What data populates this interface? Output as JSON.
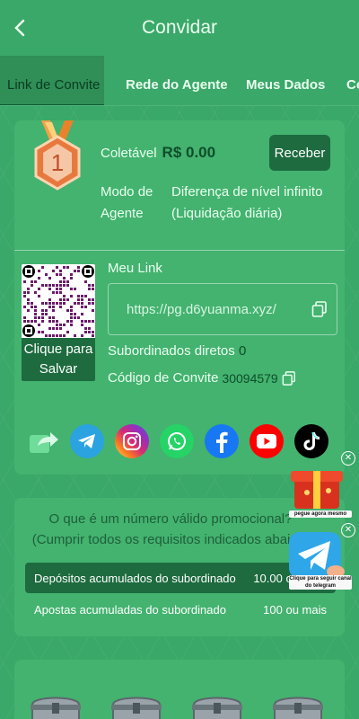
{
  "header": {
    "title": "Convidar"
  },
  "tabs": [
    {
      "label": "Link de Convite"
    },
    {
      "label": "Rede do Agente"
    },
    {
      "label": "Meus Dados"
    },
    {
      "label": "Co"
    }
  ],
  "reward": {
    "medal_number": "1",
    "collect_label": "Coletável",
    "collect_amount": "R$ 0.00",
    "receive_button": "Receber",
    "mode_label": "Modo de Agente",
    "mode_value": "Diferença de nível infinito (Liquidação diária)"
  },
  "invite": {
    "qr_caption": "Clique para Salvar",
    "my_link_label": "Meu Link",
    "link": "https://pg.d6yuanma.xyz/",
    "direct_subordinates_label": "Subordinados diretos",
    "direct_subordinates_value": "0",
    "invite_code_label": "Código de Convite",
    "invite_code_value": "30094579"
  },
  "share": [
    {
      "icon": "share-icon",
      "color": "#5ccf8c"
    },
    {
      "icon": "telegram-icon",
      "color": "#2aa3e0"
    },
    {
      "icon": "instagram-icon",
      "color": "#d62976"
    },
    {
      "icon": "whatsapp-icon",
      "color": "#25d366"
    },
    {
      "icon": "facebook-icon",
      "color": "#1877f2"
    },
    {
      "icon": "youtube-icon",
      "color": "#ff0000"
    },
    {
      "icon": "tiktok-icon",
      "color": "#000000"
    }
  ],
  "requirements": {
    "question": "O que é um número válido promocional? (Cumprir todos os requisitos indicados abaixo)",
    "rows": [
      {
        "label": "Depósitos acumulados do subordinado",
        "value": "10.00 ou mais"
      },
      {
        "label": "Apostas acumuladas do subordinado",
        "value": "100 ou mais"
      }
    ]
  },
  "promos": [
    {
      "label": "pegue agora mesmo"
    },
    {
      "label": "Clique para seguir canal do telegram"
    }
  ],
  "colors": {
    "background": "#3aa868",
    "card": "#43b36f",
    "dark_green": "#1d6b3f",
    "accent_text": "#0e4d2a"
  }
}
